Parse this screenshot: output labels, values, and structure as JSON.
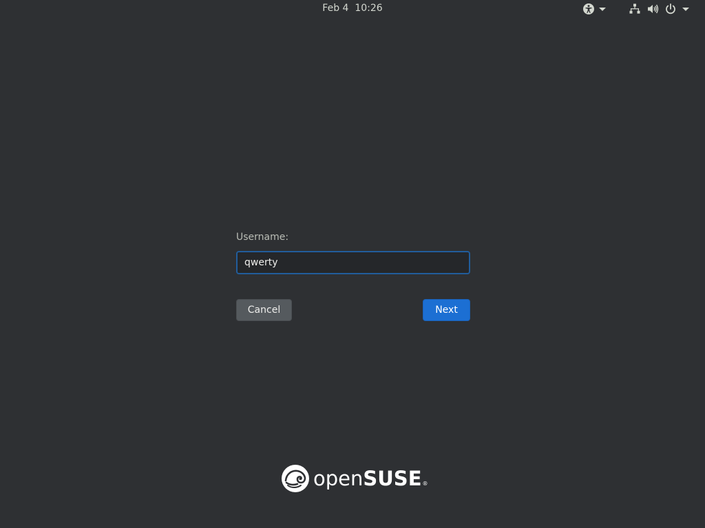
{
  "topbar": {
    "clock": "Feb 4  10:26",
    "icons": {
      "accessibility": "accessibility-icon",
      "network": "network-wired-icon",
      "volume": "volume-icon",
      "power": "power-icon",
      "dropdown": "chevron-down-icon"
    }
  },
  "login": {
    "username_label": "Username:",
    "username_value": "qwerty",
    "cancel_label": "Cancel",
    "next_label": "Next"
  },
  "branding": {
    "logo_text_light": "open",
    "logo_text_bold": "SUSE",
    "logo_registered": "®"
  },
  "colors": {
    "background": "#2e3033",
    "focus_border": "#215d9c",
    "primary_button": "#1c6fd3",
    "secondary_button": "#555a5e"
  }
}
